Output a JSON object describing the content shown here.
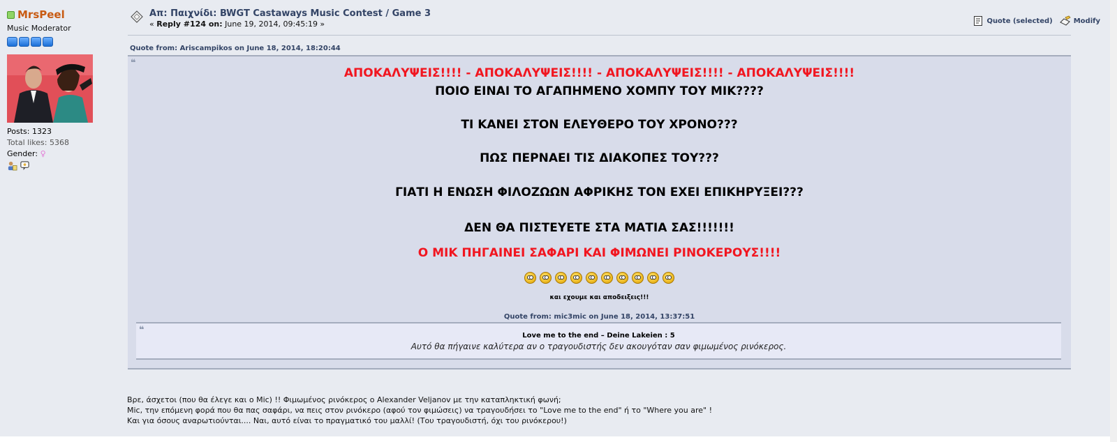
{
  "poster": {
    "name": "MrsPeel",
    "title": "Music Moderator",
    "star_count": 4,
    "posts_label": "Posts: 1323",
    "likes_label": "Total likes: 5368",
    "gender_label": "Gender:",
    "gender_symbol": "♀"
  },
  "post": {
    "subject": "Απ: Παιχνίδι: BWGT Castaways Music Contest / Game 3",
    "reply_prefix": "« ",
    "reply_label": "Reply #124 on:",
    "reply_date": " June 19, 2014, 09:45:19 »",
    "actions": {
      "quote": "Quote (selected)",
      "modify": "Modify"
    }
  },
  "quote1": {
    "header": "Quote from: Ariscampikos on June 18, 2014, 18:20:44",
    "mark": "❝",
    "lines": [
      "ΑΠΟΚΑΛΥΨΕΙΣ!!!! - ΑΠΟΚΑΛΥΨΕΙΣ!!!! - ΑΠΟΚΑΛΥΨΕΙΣ!!!! - ΑΠΟΚΑΛΥΨΕΙΣ!!!!",
      "ΠΟΙΟ ΕΙΝΑΙ ΤΟ ΑΓΑΠΗΜΕΝΟ ΧΟΜΠΥ ΤΟΥ ΜΙΚ????",
      "ΤΙ ΚΑΝΕΙ ΣΤΟΝ ΕΛΕΥΘΕΡΟ ΤΟΥ ΧΡΟΝΟ???",
      "ΠΩΣ ΠΕΡΝΑΕΙ ΤΙΣ ΔΙΑΚΟΠΕΣ ΤΟΥ???",
      "ΓΙΑΤΙ Η ΕΝΩΣΗ ΦΙΛΟΖΩΩΝ ΑΦΡΙΚΗΣ ΤΟΝ ΕΧΕΙ ΕΠΙΚΗΡΥΞΕΙ???",
      "ΔΕΝ ΘΑ ΠΙΣΤΕΥΕΤΕ ΣΤΑ ΜΑΤΙΑ ΣΑΣ!!!!!!!",
      "Ο ΜΙΚ ΠΗΓΑΙΝΕΙ ΣΑΦΑΡΙ ΚΑΙ ΦΙΜΩΝΕΙ ΡΙΝΟΚΕΡΟΥΣ!!!!"
    ],
    "emoji_count": 10,
    "emoji_name": "shocked-smiley",
    "evidence": "και εχουμε και αποδειξεις!!!"
  },
  "quote2": {
    "header": "Quote from: mic3mic on June 18, 2014, 13:37:51",
    "mark": "❝",
    "line1": "Love me to the end – Deine Lakeien : 5",
    "line2": "Αυτό θα πήγαινε καλύτερα αν ο τραγουδιστής δεν ακουγόταν σαν φιμωμένος ρινόκερος."
  },
  "body": {
    "lines": [
      "Βρε, άσχετοι (που θα έλεγε και ο Mic) !! Φιμωμένος ρινόκερος ο Alexander Veljanov με την καταπληκτική φωνή;",
      "Mic, την επόμενη φορά που θα πας σαφάρι, να πεις στον ρινόκερο (αφού τον φιμώσεις) να τραγουδήσει το \"Love me to the end\" ή το \"Where you are\" !",
      "Και για όσους αναρωτιούνται.... Ναι, αυτό είναι το πραγματικό του μαλλί! (Του τραγουδιστή, όχι του ρινόκερου!)"
    ]
  },
  "colors": {
    "accent": "#334466",
    "red": "#f11620",
    "name": "#c85b13"
  }
}
